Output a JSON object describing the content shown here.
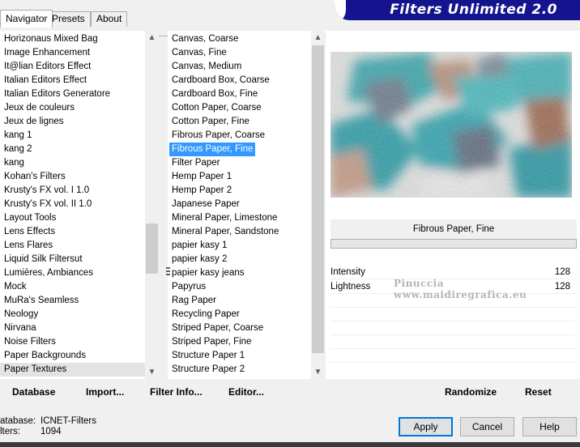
{
  "tabs": [
    "Navigator",
    "Presets",
    "About"
  ],
  "title": "Filters Unlimited 2.0",
  "categories": [
    "Horizonaus Mixed Bag",
    "Image Enhancement",
    "It@lian Editors Effect",
    "Italian Editors Effect",
    "Italian Editors Generatore",
    "Jeux de couleurs",
    "Jeux de lignes",
    "kang 1",
    "kang 2",
    "kang",
    "Kohan's Filters",
    "Krusty's FX vol. I 1.0",
    "Krusty's FX vol. II 1.0",
    "Layout Tools",
    "Lens Effects",
    "Lens Flares",
    "Liquid Silk Filtersut",
    "Lumières, Ambiances",
    "Mock",
    "MuRa's Seamless",
    "Neology",
    "Nirvana",
    "Noise Filters",
    "Paper Backgrounds",
    "Paper Textures"
  ],
  "filters": [
    "Canvas, Coarse",
    "Canvas, Fine",
    "Canvas, Medium",
    "Cardboard Box, Coarse",
    "Cardboard Box, Fine",
    "Cotton Paper, Coarse",
    "Cotton Paper, Fine",
    "Fibrous Paper, Coarse",
    "Fibrous Paper, Fine",
    "Filter Paper",
    "Hemp Paper 1",
    "Hemp Paper 2",
    "Japanese Paper",
    "Mineral Paper, Limestone",
    "Mineral Paper, Sandstone",
    "papier kasy 1",
    "papier kasy 2",
    "papier kasy jeans",
    "Papyrus",
    "Rag Paper",
    "Recycling Paper",
    "Striped Paper, Coarse",
    "Striped Paper, Fine",
    "Structure Paper 1",
    "Structure Paper 2"
  ],
  "selected_category": "Paper Textures",
  "selected_filter": "Fibrous Paper, Fine",
  "preview": {
    "filter_name": "Fibrous Paper, Fine",
    "params": [
      {
        "label": "Intensity",
        "value": "128"
      },
      {
        "label": "Lightness",
        "value": "128"
      }
    ]
  },
  "left_buttons": {
    "database": "Database",
    "import": "Import...",
    "filter_info": "Filter Info...",
    "editor": "Editor..."
  },
  "right_buttons": {
    "randomize": "Randomize",
    "reset": "Reset"
  },
  "footer": {
    "database_label": "atabase:",
    "database_value": "ICNET-Filters",
    "filters_label": "lters:",
    "filters_value": "1094"
  },
  "dialog_buttons": {
    "apply": "Apply",
    "cancel": "Cancel",
    "help": "Help"
  },
  "watermark": "Pinuccia www.maidiregrafica.eu",
  "colors": {
    "banner": "#14148f",
    "selection": "#3399ff"
  }
}
